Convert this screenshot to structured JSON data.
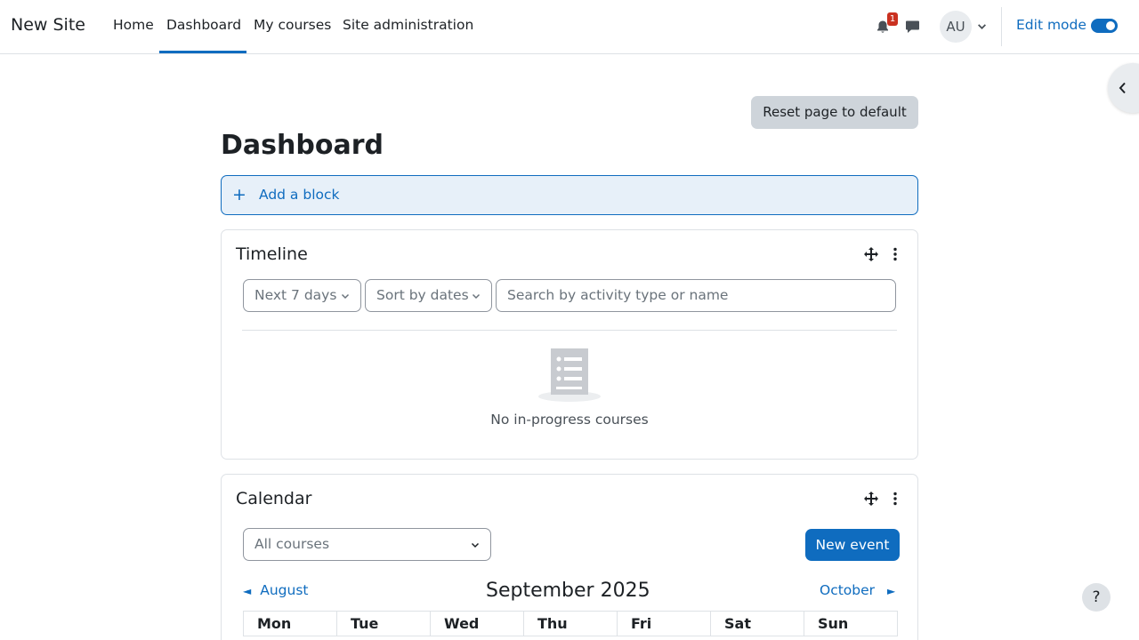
{
  "navbar": {
    "brand": "New Site",
    "items": [
      {
        "label": "Home"
      },
      {
        "label": "Dashboard"
      },
      {
        "label": "My courses"
      },
      {
        "label": "Site administration"
      }
    ],
    "notification_count": "1",
    "user_initials": "AU",
    "edit_mode_label": "Edit mode"
  },
  "page": {
    "reset_label": "Reset page to default",
    "title": "Dashboard",
    "add_block_label": "Add a block"
  },
  "timeline": {
    "title": "Timeline",
    "filter_label": "Next 7 days",
    "sort_label": "Sort by dates",
    "search_placeholder": "Search by activity type or name",
    "empty_text": "No in-progress courses"
  },
  "calendar": {
    "title": "Calendar",
    "course_select": "All courses",
    "new_event_label": "New event",
    "prev_month": "August",
    "current_month": "September 2025",
    "next_month": "October",
    "prev_arrow": "◄",
    "next_arrow": "►",
    "weekdays": [
      "Mon",
      "Tue",
      "Wed",
      "Thu",
      "Fri",
      "Sat",
      "Sun"
    ]
  },
  "help_label": "?",
  "colors": {
    "primary": "#0f6cbf",
    "badge": "#ca3120"
  }
}
